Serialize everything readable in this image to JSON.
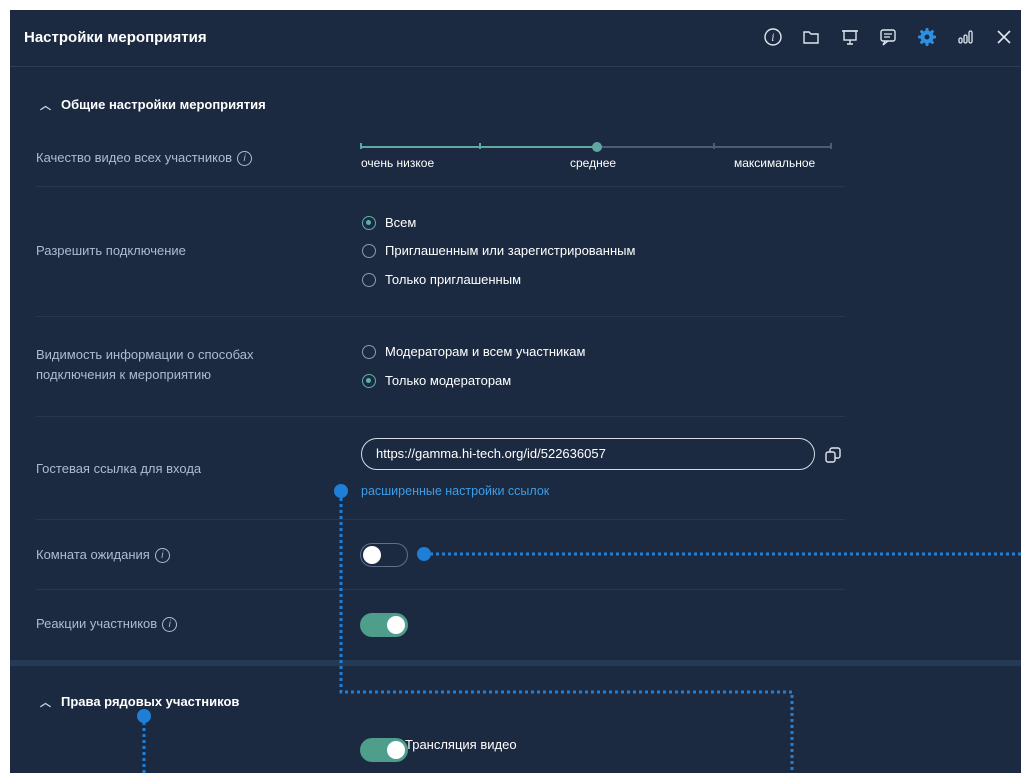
{
  "header": {
    "title": "Настройки мероприятия",
    "icons": [
      "info-icon",
      "folder-icon",
      "presentation-icon",
      "chat-icon",
      "gear-icon",
      "stats-icon",
      "close-icon"
    ]
  },
  "general": {
    "section_title": "Общие настройки мероприятия",
    "video_quality": {
      "label": "Качество видео всех участников",
      "options": [
        "очень низкое",
        "среднее",
        "максимальное"
      ],
      "selected": "среднее",
      "level_fraction": 0.5
    },
    "allow_connection": {
      "label": "Разрешить подключение",
      "options": [
        "Всем",
        "Приглашенным или зарегистрированным",
        "Только приглашенным"
      ],
      "selected": "Всем"
    },
    "visibility": {
      "label_line1": "Видимость информации о способах",
      "label_line2": "подключения к мероприятию",
      "options": [
        "Модераторам и всем участникам",
        "Только модераторам"
      ],
      "selected": "Только модераторам"
    },
    "guest_link": {
      "label": "Гостевая ссылка для входа",
      "value": "https://gamma.hi-tech.org/id/522636057",
      "advanced_link": "расширенные настройки ссылок"
    },
    "waiting_room": {
      "label": "Комната ожидания",
      "enabled": false
    },
    "reactions": {
      "label": "Реакции участников",
      "enabled": true
    }
  },
  "rights": {
    "section_title": "Права рядовых участников",
    "video_broadcast": {
      "label": "Трансляция видео",
      "enabled": true
    }
  },
  "colors": {
    "panel_bg": "#1b2a41",
    "accent_teal": "#4f9e8c",
    "accent_blue": "#3d9de6",
    "annotation_blue": "#1f7fd6"
  }
}
